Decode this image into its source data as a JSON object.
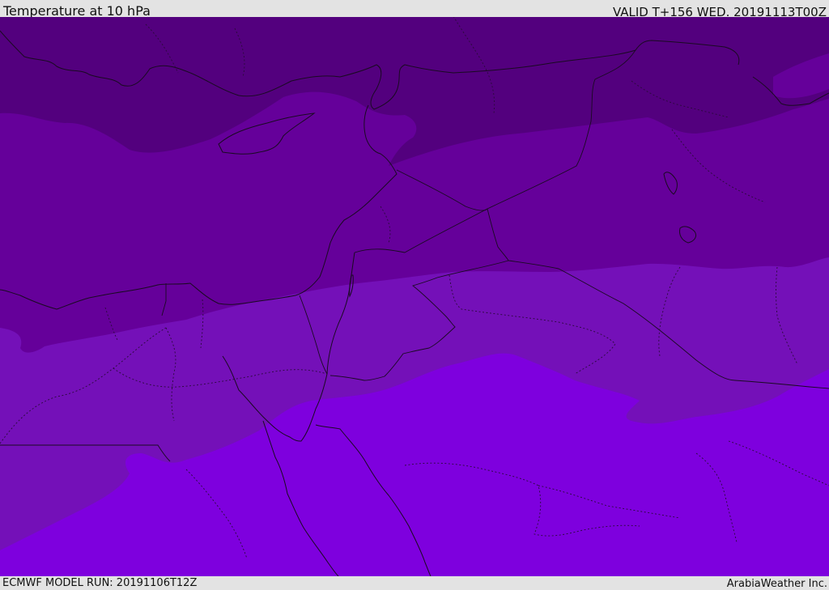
{
  "header": {
    "title": "Temperature at 10 hPa",
    "valid": "VALID T+156 WED. 20191113T00Z"
  },
  "footer": {
    "model_run": "ECMWF MODEL RUN: 20191106T12Z",
    "credit": "ArabiaWeather Inc."
  },
  "map": {
    "colors": {
      "darkest_band": "#53007e",
      "dark_band": "#65009a",
      "mid_band": "#7410b8",
      "light_band": "#7e00de",
      "boundary_lines": "#1a0a22"
    }
  }
}
